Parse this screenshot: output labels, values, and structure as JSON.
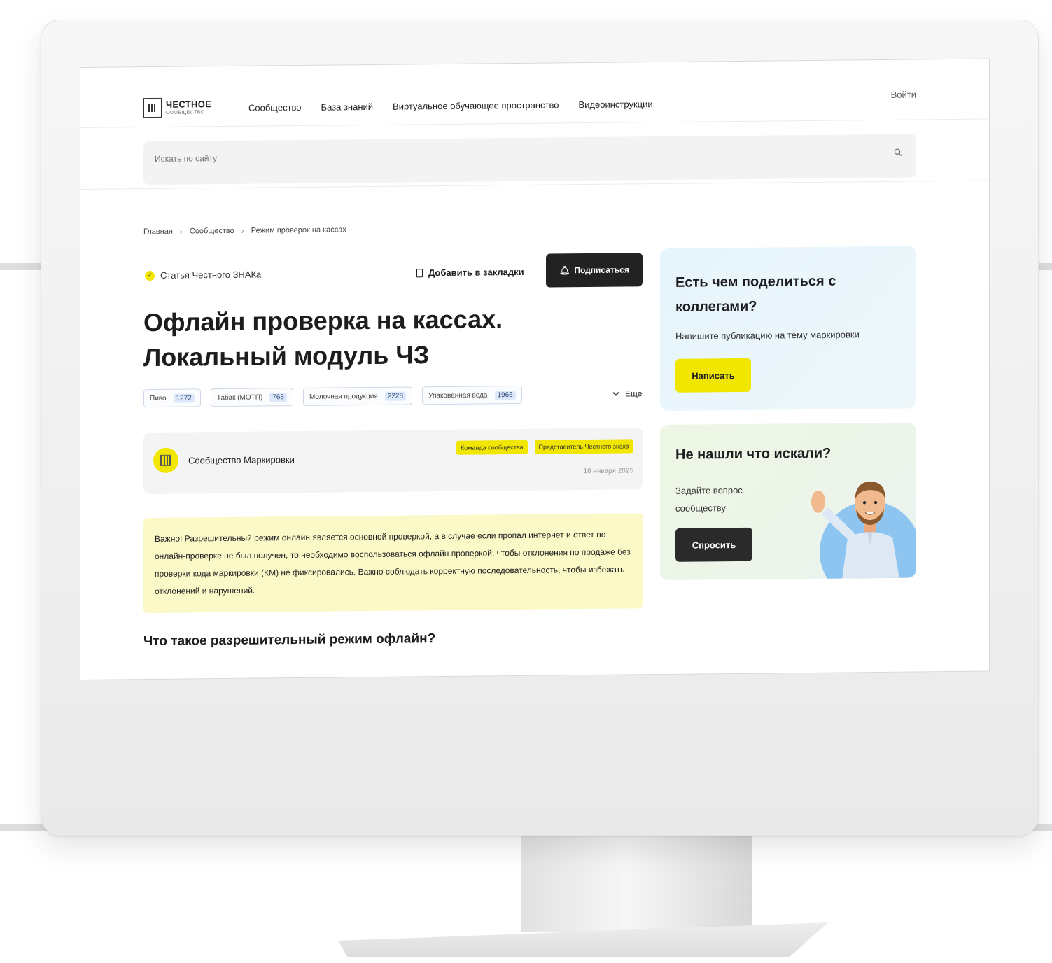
{
  "header": {
    "logo_line1": "ЧЕСТНОЕ",
    "logo_line2": "СООБЩЕСТВО",
    "nav": [
      "Сообщество",
      "База знаний",
      "Виртуальное обучающее пространство",
      "Видеоинструкции"
    ],
    "login": "Войти"
  },
  "search": {
    "placeholder": "Искать по сайту",
    "icon": "search-icon"
  },
  "breadcrumb": [
    "Главная",
    "Сообщество",
    "Режим проверок на кассах"
  ],
  "article": {
    "badge": "Статья Честного ЗНАКа",
    "bookmark": "Добавить в закладки",
    "subscribe": "Подписаться",
    "title": "Офлайн проверка на кассах. Локальный модуль ЧЗ",
    "tags": [
      {
        "label": "Пиво",
        "count": "1272"
      },
      {
        "label": "Табак (МОТП)",
        "count": "768"
      },
      {
        "label": "Молочная продукция",
        "count": "2228"
      },
      {
        "label": "Упакованная вода",
        "count": "1965"
      }
    ],
    "more": "Еще",
    "author": {
      "name": "Сообщество Маркировки",
      "roles": [
        "Команда сообщества",
        "Представитель Честного знака"
      ],
      "date": "16 января 2025"
    },
    "notice": "Важно! Разрешительный режим онлайн является основной проверкой, а в случае если пропал интернет и ответ по онлайн-проверке не был получен, то необходимо воспользоваться офлайн проверкой, чтобы отклонения по продаже без проверки кода маркировки (КМ) не фиксировались. Важно соблюдать корректную последовательность, чтобы избежать отклонений и нарушений.",
    "heading2": "Что такое разрешительный режим офлайн?"
  },
  "sidebar": {
    "share": {
      "title": "Есть чем поделиться с коллегами?",
      "text": "Напишите публикацию на тему маркировки",
      "button": "Написать"
    },
    "ask": {
      "title": "Не нашли что искали?",
      "text": "Задайте вопрос сообществу",
      "button": "Спросить"
    }
  },
  "colors": {
    "accent": "#f0e600",
    "dark": "#222222",
    "notice_bg": "#fbf9c8",
    "share_bg": "#e6f4fb",
    "ask_bg": "#eef6e5"
  }
}
